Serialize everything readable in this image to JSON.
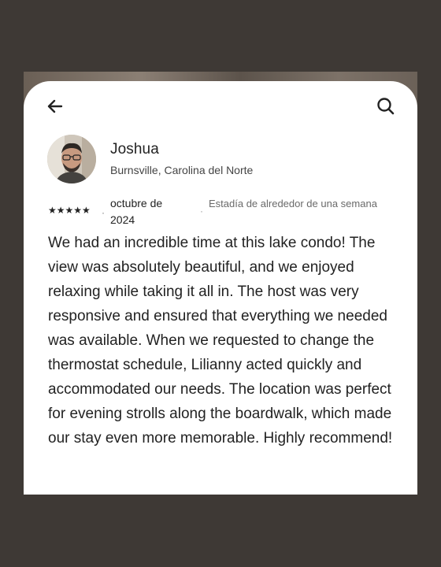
{
  "review": {
    "reviewer_name": "Joshua",
    "reviewer_location": "Burnsville, Carolina del Norte",
    "rating": 5,
    "stars_display": "★★★★★",
    "separator": "·",
    "date": "octubre de 2024",
    "stay_length": "Estadía de alrededor de una semana",
    "text": "We had an incredible time at this lake condo! The view was absolutely beautiful, and we enjoyed relaxing while taking it all in. The host was very responsive and ensured that everything we needed was available. When we requested to change the thermostat schedule, Lilianny acted quickly and accommodated our needs. The location was perfect for evening strolls along the boardwalk, which made our stay even more memorable. Highly recommend!"
  },
  "header": {
    "back_icon": "arrow-left-icon",
    "search_icon": "search-icon"
  },
  "colors": {
    "background": "#3e3935",
    "card": "#ffffff",
    "text_primary": "#222222",
    "text_secondary": "#6a6a6a"
  }
}
